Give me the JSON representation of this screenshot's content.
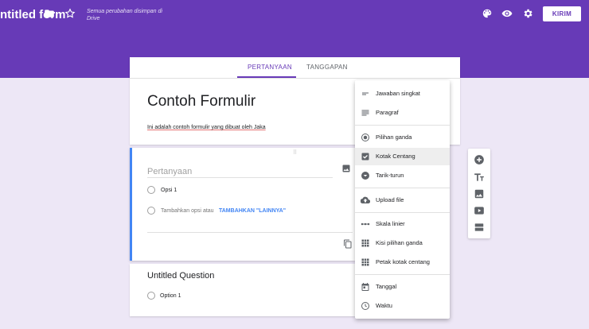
{
  "header": {
    "form_title": "ntitled form",
    "saved_status": "Semua perubahan disimpan di Drive",
    "send_label": "KIRIM",
    "icons": [
      "folder-icon",
      "star-icon",
      "palette-icon",
      "eye-icon",
      "gear-icon"
    ]
  },
  "tabs": {
    "questions_label": "PERTANYAAN",
    "responses_label": "TANGGAPAN"
  },
  "form": {
    "title": "Contoh Formulir",
    "description": "Ini adalah contoh formulir yang dibuat oleh Jaka"
  },
  "question": {
    "placeholder": "Pertanyaan",
    "option_1": "Opsi 1",
    "add_option": "Tambahkan opsi",
    "or": "atau",
    "add_other": "TAMBAHKAN \"LAINNYA\""
  },
  "question2": {
    "title": "Untitled Question",
    "option_1": "Option 1"
  },
  "menu": {
    "items": [
      {
        "label": "Jawaban singkat",
        "icon": "short-text-icon"
      },
      {
        "label": "Paragraf",
        "icon": "paragraph-icon"
      },
      {
        "label": "Pilihan ganda",
        "icon": "radio-icon"
      },
      {
        "label": "Kotak Centang",
        "icon": "checkbox-icon"
      },
      {
        "label": "Tarik-turun",
        "icon": "dropdown-icon"
      },
      {
        "label": "Upload file",
        "icon": "cloud-upload-icon"
      },
      {
        "label": "Skala linier",
        "icon": "linear-scale-icon"
      },
      {
        "label": "Kisi pilihan ganda",
        "icon": "grid-icon"
      },
      {
        "label": "Petak kotak centang",
        "icon": "checkbox-grid-icon"
      },
      {
        "label": "Tanggal",
        "icon": "calendar-icon"
      },
      {
        "label": "Waktu",
        "icon": "clock-icon"
      }
    ],
    "selected": "Kotak Centang"
  },
  "colors": {
    "brand": "#673ab7",
    "background": "#ede7f6",
    "active_accent": "#4285f4"
  }
}
